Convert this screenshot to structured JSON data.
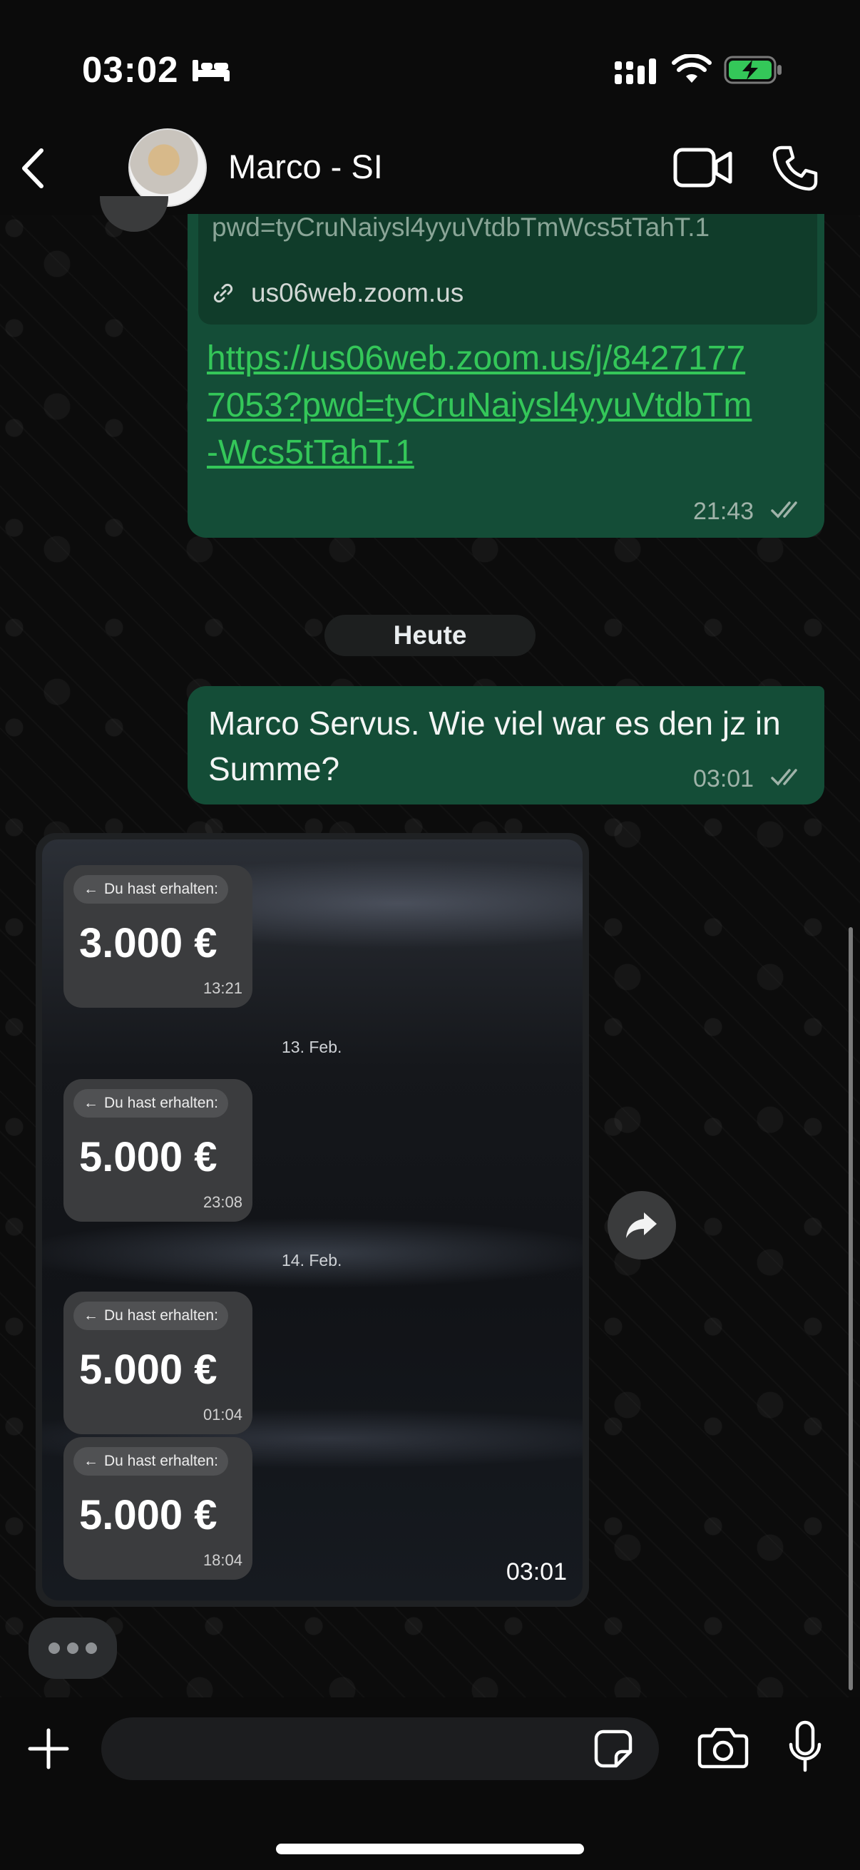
{
  "status_bar": {
    "time": "03:02"
  },
  "header": {
    "contact_name": "Marco - SI"
  },
  "messages": {
    "link": {
      "preview_pwd": "pwd=tyCruNaiysl4yyuVtdbTmWcs5tTahT.1",
      "preview_domain": "us06web.zoom.us",
      "url": "https://us06web.zoom.us/j/84271777053?pwd=tyCruNaiysl4yyuVtdbTm-Wcs5tTahT.1",
      "time": "21:43"
    },
    "date_separator": "Heute",
    "text": {
      "body": "Marco Servus. Wie viel war es den jz in Summe?",
      "time": "03:01"
    },
    "image": {
      "time": "03:01",
      "receipts": [
        {
          "label": "Du hast erhalten:",
          "amount": "3.000 €",
          "time": "13:21"
        },
        {
          "label": "Du hast erhalten:",
          "amount": "5.000 €",
          "time": "23:08"
        },
        {
          "label": "Du hast erhalten:",
          "amount": "5.000 €",
          "time": "01:04"
        },
        {
          "label": "Du hast erhalten:",
          "amount": "5.000 €",
          "time": "18:04"
        }
      ],
      "dates": [
        "13. Feb.",
        "14. Feb."
      ]
    }
  },
  "composer": {
    "placeholder": ""
  },
  "colors": {
    "outgoing_bubble": "#144d37",
    "link": "#34c759",
    "background": "#0b0b0b"
  }
}
